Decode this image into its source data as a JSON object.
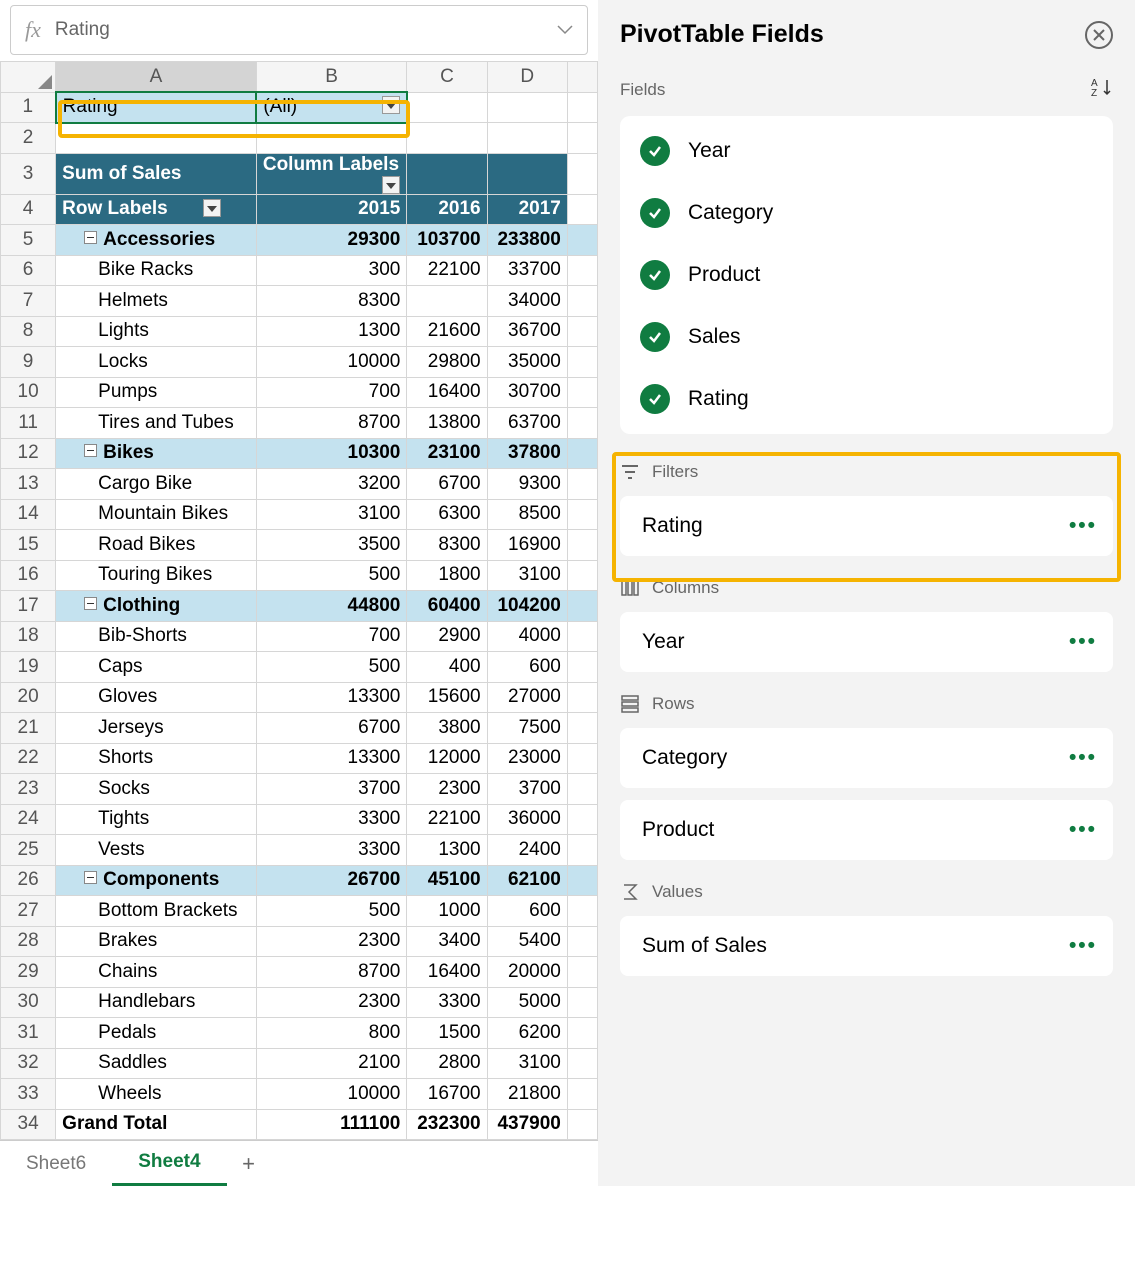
{
  "formula_bar": {
    "value": "Rating"
  },
  "columns": [
    "A",
    "B",
    "C",
    "D"
  ],
  "filter_row": {
    "label": "Rating",
    "value": "(All)"
  },
  "pivot": {
    "sum_label": "Sum of Sales",
    "col_label": "Column Labels",
    "row_label": "Row Labels",
    "years": [
      "2015",
      "2016",
      "2017"
    ],
    "groups": [
      {
        "name": "Accessories",
        "totals": [
          "29300",
          "103700",
          "233800"
        ],
        "items": [
          {
            "name": "Bike Racks",
            "vals": [
              "300",
              "22100",
              "33700"
            ]
          },
          {
            "name": "Helmets",
            "vals": [
              "8300",
              "",
              "34000"
            ]
          },
          {
            "name": "Lights",
            "vals": [
              "1300",
              "21600",
              "36700"
            ]
          },
          {
            "name": "Locks",
            "vals": [
              "10000",
              "29800",
              "35000"
            ]
          },
          {
            "name": "Pumps",
            "vals": [
              "700",
              "16400",
              "30700"
            ]
          },
          {
            "name": "Tires and Tubes",
            "vals": [
              "8700",
              "13800",
              "63700"
            ]
          }
        ]
      },
      {
        "name": "Bikes",
        "totals": [
          "10300",
          "23100",
          "37800"
        ],
        "items": [
          {
            "name": "Cargo Bike",
            "vals": [
              "3200",
              "6700",
              "9300"
            ]
          },
          {
            "name": "Mountain Bikes",
            "vals": [
              "3100",
              "6300",
              "8500"
            ]
          },
          {
            "name": "Road Bikes",
            "vals": [
              "3500",
              "8300",
              "16900"
            ]
          },
          {
            "name": "Touring Bikes",
            "vals": [
              "500",
              "1800",
              "3100"
            ]
          }
        ]
      },
      {
        "name": "Clothing",
        "totals": [
          "44800",
          "60400",
          "104200"
        ],
        "items": [
          {
            "name": "Bib-Shorts",
            "vals": [
              "700",
              "2900",
              "4000"
            ]
          },
          {
            "name": "Caps",
            "vals": [
              "500",
              "400",
              "600"
            ]
          },
          {
            "name": "Gloves",
            "vals": [
              "13300",
              "15600",
              "27000"
            ]
          },
          {
            "name": "Jerseys",
            "vals": [
              "6700",
              "3800",
              "7500"
            ]
          },
          {
            "name": "Shorts",
            "vals": [
              "13300",
              "12000",
              "23000"
            ]
          },
          {
            "name": "Socks",
            "vals": [
              "3700",
              "2300",
              "3700"
            ]
          },
          {
            "name": "Tights",
            "vals": [
              "3300",
              "22100",
              "36000"
            ]
          },
          {
            "name": "Vests",
            "vals": [
              "3300",
              "1300",
              "2400"
            ]
          }
        ]
      },
      {
        "name": "Components",
        "totals": [
          "26700",
          "45100",
          "62100"
        ],
        "items": [
          {
            "name": "Bottom Brackets",
            "vals": [
              "500",
              "1000",
              "600"
            ]
          },
          {
            "name": "Brakes",
            "vals": [
              "2300",
              "3400",
              "5400"
            ]
          },
          {
            "name": "Chains",
            "vals": [
              "8700",
              "16400",
              "20000"
            ]
          },
          {
            "name": "Handlebars",
            "vals": [
              "2300",
              "3300",
              "5000"
            ]
          },
          {
            "name": "Pedals",
            "vals": [
              "800",
              "1500",
              "6200"
            ]
          },
          {
            "name": "Saddles",
            "vals": [
              "2100",
              "2800",
              "3100"
            ]
          },
          {
            "name": "Wheels",
            "vals": [
              "10000",
              "16700",
              "21800"
            ]
          }
        ]
      }
    ],
    "grand_label": "Grand Total",
    "grand_totals": [
      "111100",
      "232300",
      "437900"
    ]
  },
  "tabs": {
    "inactive": "Sheet6",
    "active": "Sheet4"
  },
  "panel": {
    "title": "PivotTable Fields",
    "fields_label": "Fields",
    "fields": [
      "Year",
      "Category",
      "Product",
      "Sales",
      "Rating"
    ],
    "filters": {
      "label": "Filters",
      "items": [
        "Rating"
      ]
    },
    "columns": {
      "label": "Columns",
      "items": [
        "Year"
      ]
    },
    "rows": {
      "label": "Rows",
      "items": [
        "Category",
        "Product"
      ]
    },
    "values": {
      "label": "Values",
      "items": [
        "Sum of Sales"
      ]
    }
  }
}
